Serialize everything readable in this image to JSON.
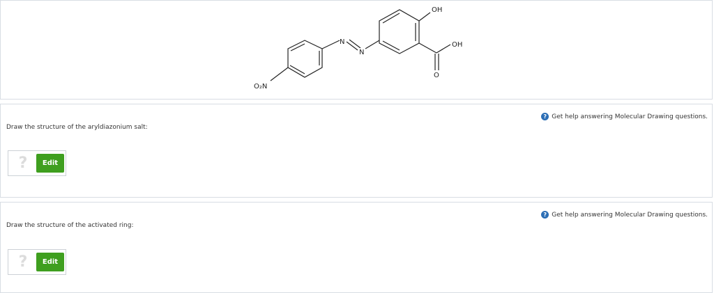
{
  "structure": {
    "labels": {
      "nitro_group": "O₂N",
      "azo_n1": "N",
      "azo_n2": "N",
      "hydroxyl_top": "OH",
      "acid_oh": "OH",
      "carbonyl_o": "O"
    }
  },
  "questions": [
    {
      "help_text": "Get help answering Molecular Drawing questions.",
      "help_icon": "?",
      "prompt": "Draw the structure of the aryldiazonium salt:",
      "placeholder_glyph": "?",
      "edit_label": "Edit"
    },
    {
      "help_text": "Get help answering Molecular Drawing questions.",
      "help_icon": "?",
      "prompt": "Draw the structure of the activated ring:",
      "placeholder_glyph": "?",
      "edit_label": "Edit"
    }
  ],
  "colors": {
    "edit_button": "#3f9f1f",
    "help_icon": "#2c6eb5",
    "panel_border": "#d8dde3"
  }
}
